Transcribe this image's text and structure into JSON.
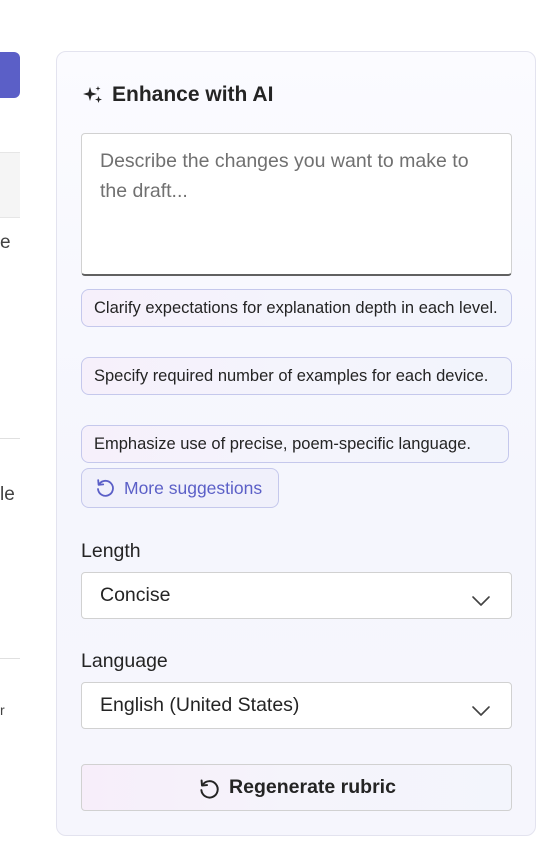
{
  "left_column": {
    "fragments": [
      "e",
      "le",
      "r"
    ]
  },
  "panel": {
    "title": "Enhance with AI",
    "title_icon": "sparkle-icon",
    "prompt": {
      "value": "",
      "placeholder": "Describe the changes you want to make to the draft..."
    },
    "suggestions": [
      "Clarify expectations for explanation depth in each level.",
      "Specify required number of examples for each device.",
      "Emphasize use of precise, poem-specific language."
    ],
    "more_suggestions_label": "More suggestions",
    "length": {
      "label": "Length",
      "selected": "Concise"
    },
    "language": {
      "label": "Language",
      "selected": "English (United States)"
    },
    "regenerate_label": "Regenerate rubric"
  },
  "colors": {
    "accent": "#5b5fc7",
    "panel_border": "#e3e3ef",
    "chip_border": "#c5c8ec"
  }
}
